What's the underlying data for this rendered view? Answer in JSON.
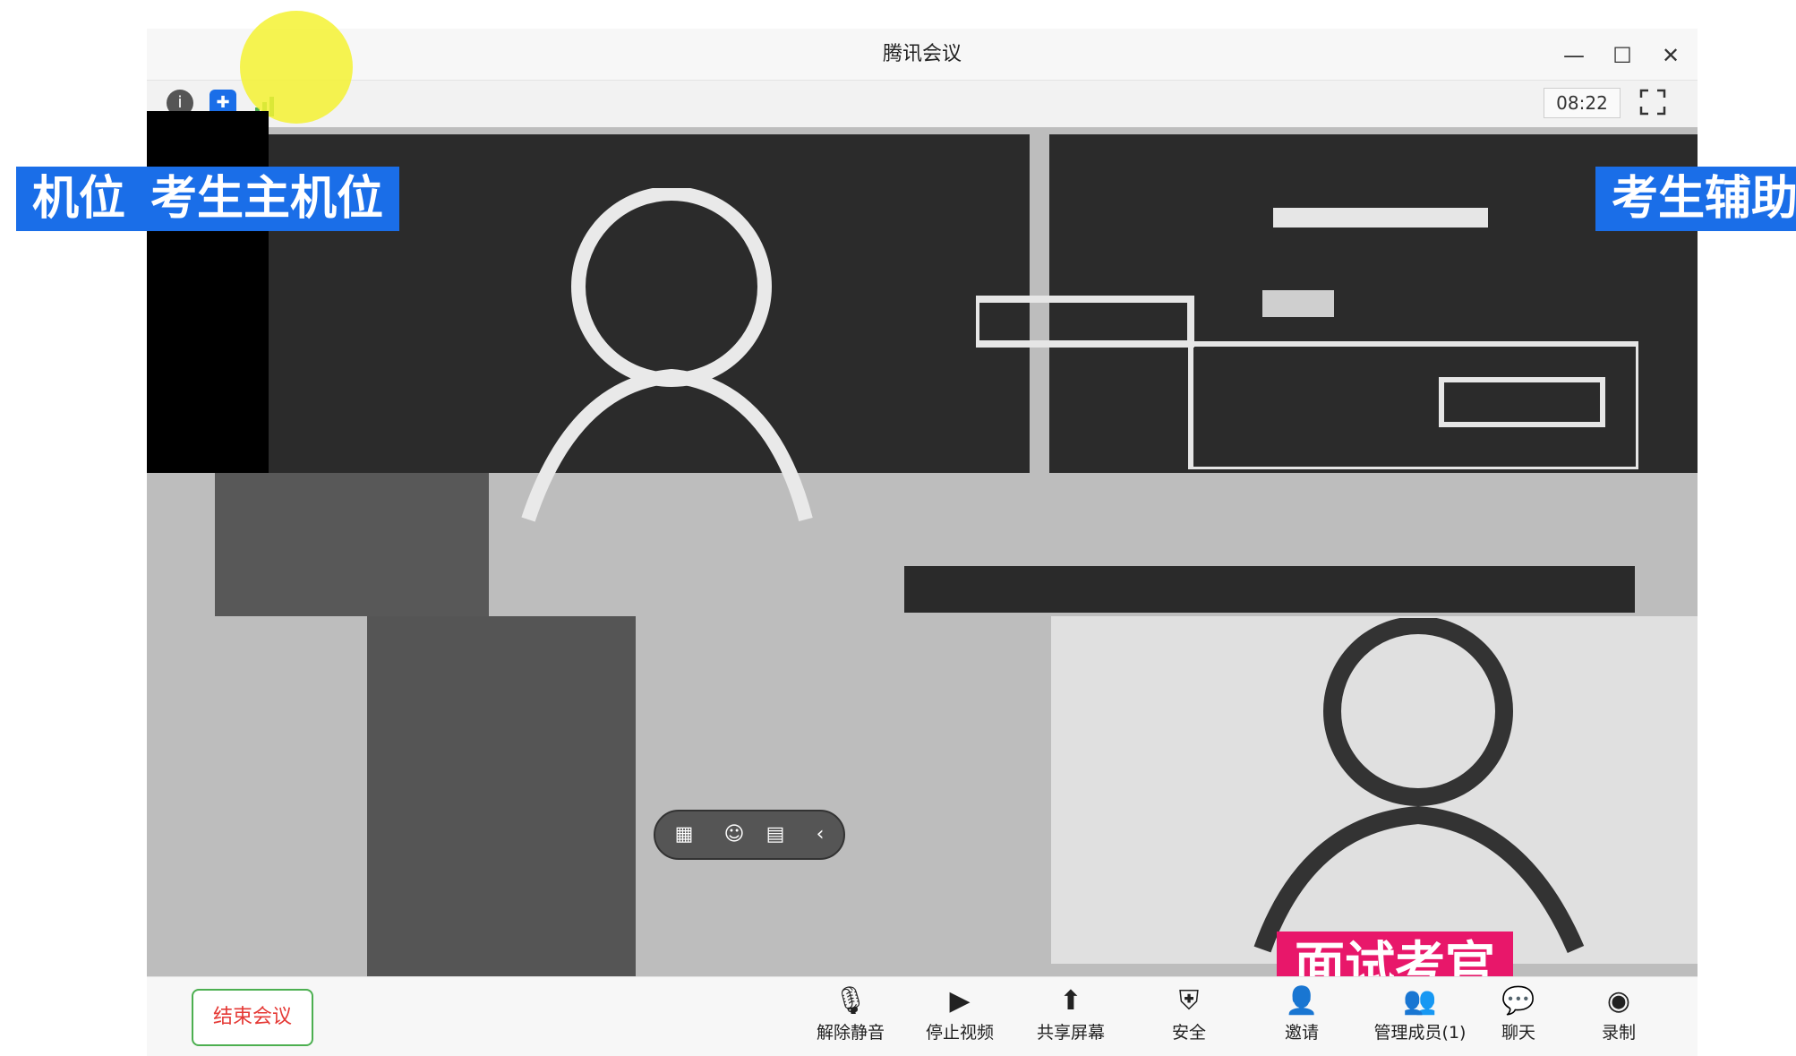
{
  "window": {
    "title": "腾讯会议",
    "controls": {
      "minimize": "—",
      "maximize": "☐",
      "close": "✕"
    }
  },
  "infobar": {
    "clock": "08:22",
    "icons": [
      "info-icon",
      "shield-icon",
      "signal-icon",
      "fullscreen-icon"
    ]
  },
  "labels": {
    "left_cut": "机位",
    "main_cam": "考生主机位",
    "aux_cam": "考生辅助",
    "examiner": "面试考官"
  },
  "floating_bar": {
    "icons": [
      "layout-icon",
      "emoji-icon",
      "chat-bubble-icon",
      "collapse-icon"
    ]
  },
  "toolbar": {
    "end_meeting": "结束会议",
    "items": [
      {
        "label": "解除静音",
        "icon": "microphone-off-icon"
      },
      {
        "label": "停止视频",
        "icon": "camera-icon"
      },
      {
        "label": "共享屏幕",
        "icon": "share-screen-icon"
      },
      {
        "label": "安全",
        "icon": "security-icon"
      },
      {
        "label": "邀请",
        "icon": "invite-icon"
      },
      {
        "label": "管理成员(1)",
        "icon": "members-icon"
      },
      {
        "label": "聊天",
        "icon": "chat-icon"
      },
      {
        "label": "录制",
        "icon": "record-icon"
      }
    ]
  },
  "colors": {
    "accent_blue": "#1a6ee8",
    "accent_pink": "#e8176a",
    "end_red": "#e53935",
    "highlight_yellow": "#f5f233"
  }
}
